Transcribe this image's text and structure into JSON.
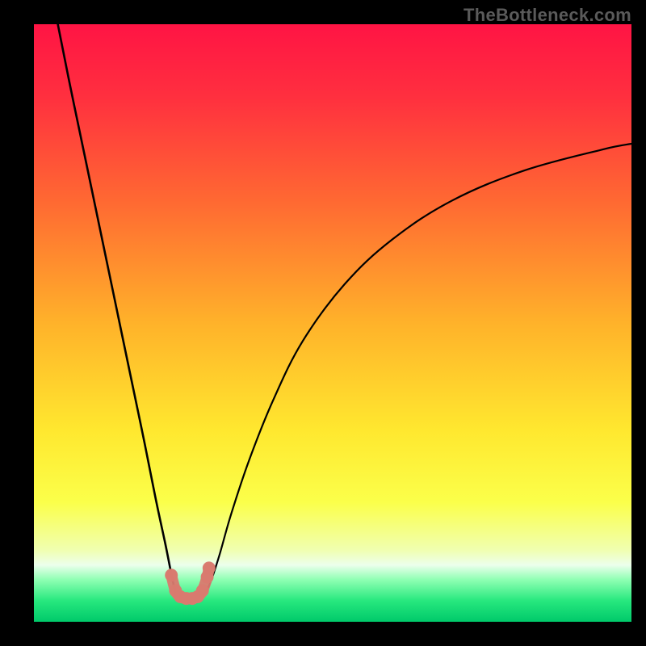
{
  "watermark": "TheBottleneck.com",
  "chart_data": {
    "type": "line",
    "title": "",
    "xlabel": "",
    "ylabel": "",
    "xlim": [
      0,
      100
    ],
    "ylim": [
      0,
      100
    ],
    "axes_visible": false,
    "grid": false,
    "legend": false,
    "background": {
      "type": "vertical-gradient",
      "stops": [
        {
          "pos": 0.0,
          "color": "#ff1444"
        },
        {
          "pos": 0.12,
          "color": "#ff2f3f"
        },
        {
          "pos": 0.3,
          "color": "#ff6a32"
        },
        {
          "pos": 0.5,
          "color": "#ffb22a"
        },
        {
          "pos": 0.68,
          "color": "#ffe82f"
        },
        {
          "pos": 0.8,
          "color": "#fbff4a"
        },
        {
          "pos": 0.88,
          "color": "#f0ffb0"
        },
        {
          "pos": 0.905,
          "color": "#ecffec"
        },
        {
          "pos": 0.93,
          "color": "#8dffb2"
        },
        {
          "pos": 0.965,
          "color": "#27e87e"
        },
        {
          "pos": 1.0,
          "color": "#00c96a"
        }
      ]
    },
    "series": [
      {
        "name": "bottleneck-curve-left",
        "description": "Steep descending branch from top-left into the valley",
        "x": [
          4.0,
          6.0,
          8.5,
          11.0,
          13.5,
          16.0,
          18.5,
          20.5,
          22.0,
          23.0,
          23.7,
          24.4
        ],
        "y": [
          100.0,
          90.0,
          78.0,
          66.0,
          54.0,
          42.0,
          30.0,
          20.0,
          13.0,
          8.0,
          5.0,
          4.3
        ]
      },
      {
        "name": "bottleneck-curve-right",
        "description": "Ascending branch from valley sweeping to upper-right, flattening",
        "x": [
          28.3,
          29.5,
          31.0,
          33.0,
          36.0,
          40.0,
          45.0,
          52.0,
          60.0,
          70.0,
          82.0,
          95.0,
          100.0
        ],
        "y": [
          4.3,
          6.5,
          11.0,
          18.0,
          27.0,
          37.0,
          47.0,
          56.5,
          64.0,
          70.5,
          75.5,
          79.0,
          80.0
        ]
      },
      {
        "name": "valley-marker-band",
        "description": "Thick salmon band/markers at valley bottom",
        "marker_color": "#d97a6f",
        "x": [
          23.0,
          23.7,
          24.5,
          25.5,
          26.5,
          27.4,
          28.2,
          29.0,
          29.3
        ],
        "y": [
          7.8,
          5.2,
          4.2,
          3.9,
          3.9,
          4.2,
          5.2,
          7.5,
          9.0
        ]
      }
    ],
    "annotations": []
  }
}
